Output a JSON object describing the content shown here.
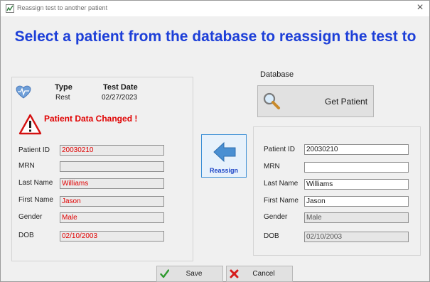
{
  "window": {
    "title": "Reassign test to another patient",
    "close_glyph": "×"
  },
  "heading": "Select a patient from the database to reassign the test to",
  "test_info": {
    "type_header": "Type",
    "type_value": "Rest",
    "date_header": "Test Date",
    "date_value": "02/27/2023"
  },
  "warning": "Patient Data Changed !",
  "labels": {
    "patient_id": "Patient ID",
    "mrn": "MRN",
    "last_name": "Last Name",
    "first_name": "First Name",
    "gender": "Gender",
    "dob": "DOB"
  },
  "current_patient": {
    "patient_id": "20030210",
    "mrn": "",
    "last_name": "Williams",
    "first_name": "Jason",
    "gender": "Male",
    "dob": "02/10/2003"
  },
  "reassign_label": "Reassign",
  "database": {
    "label": "Database",
    "get_patient_label": "Get Patient",
    "patient": {
      "patient_id": "20030210",
      "mrn": "",
      "last_name": "Williams",
      "first_name": "Jason",
      "gender": "Male",
      "dob": "02/10/2003"
    }
  },
  "buttons": {
    "save": "Save",
    "cancel": "Cancel"
  },
  "icons": {
    "heart": "heart-monitor-icon",
    "warning": "warning-triangle-icon",
    "reassign": "left-arrow-icon",
    "search": "magnifier-icon",
    "save": "checkmark-icon",
    "cancel": "red-x-icon"
  },
  "colors": {
    "heading": "#1d3fd8",
    "warning": "#e00000",
    "old_value": "#e00000",
    "reassign_border": "#3c8fd6"
  }
}
